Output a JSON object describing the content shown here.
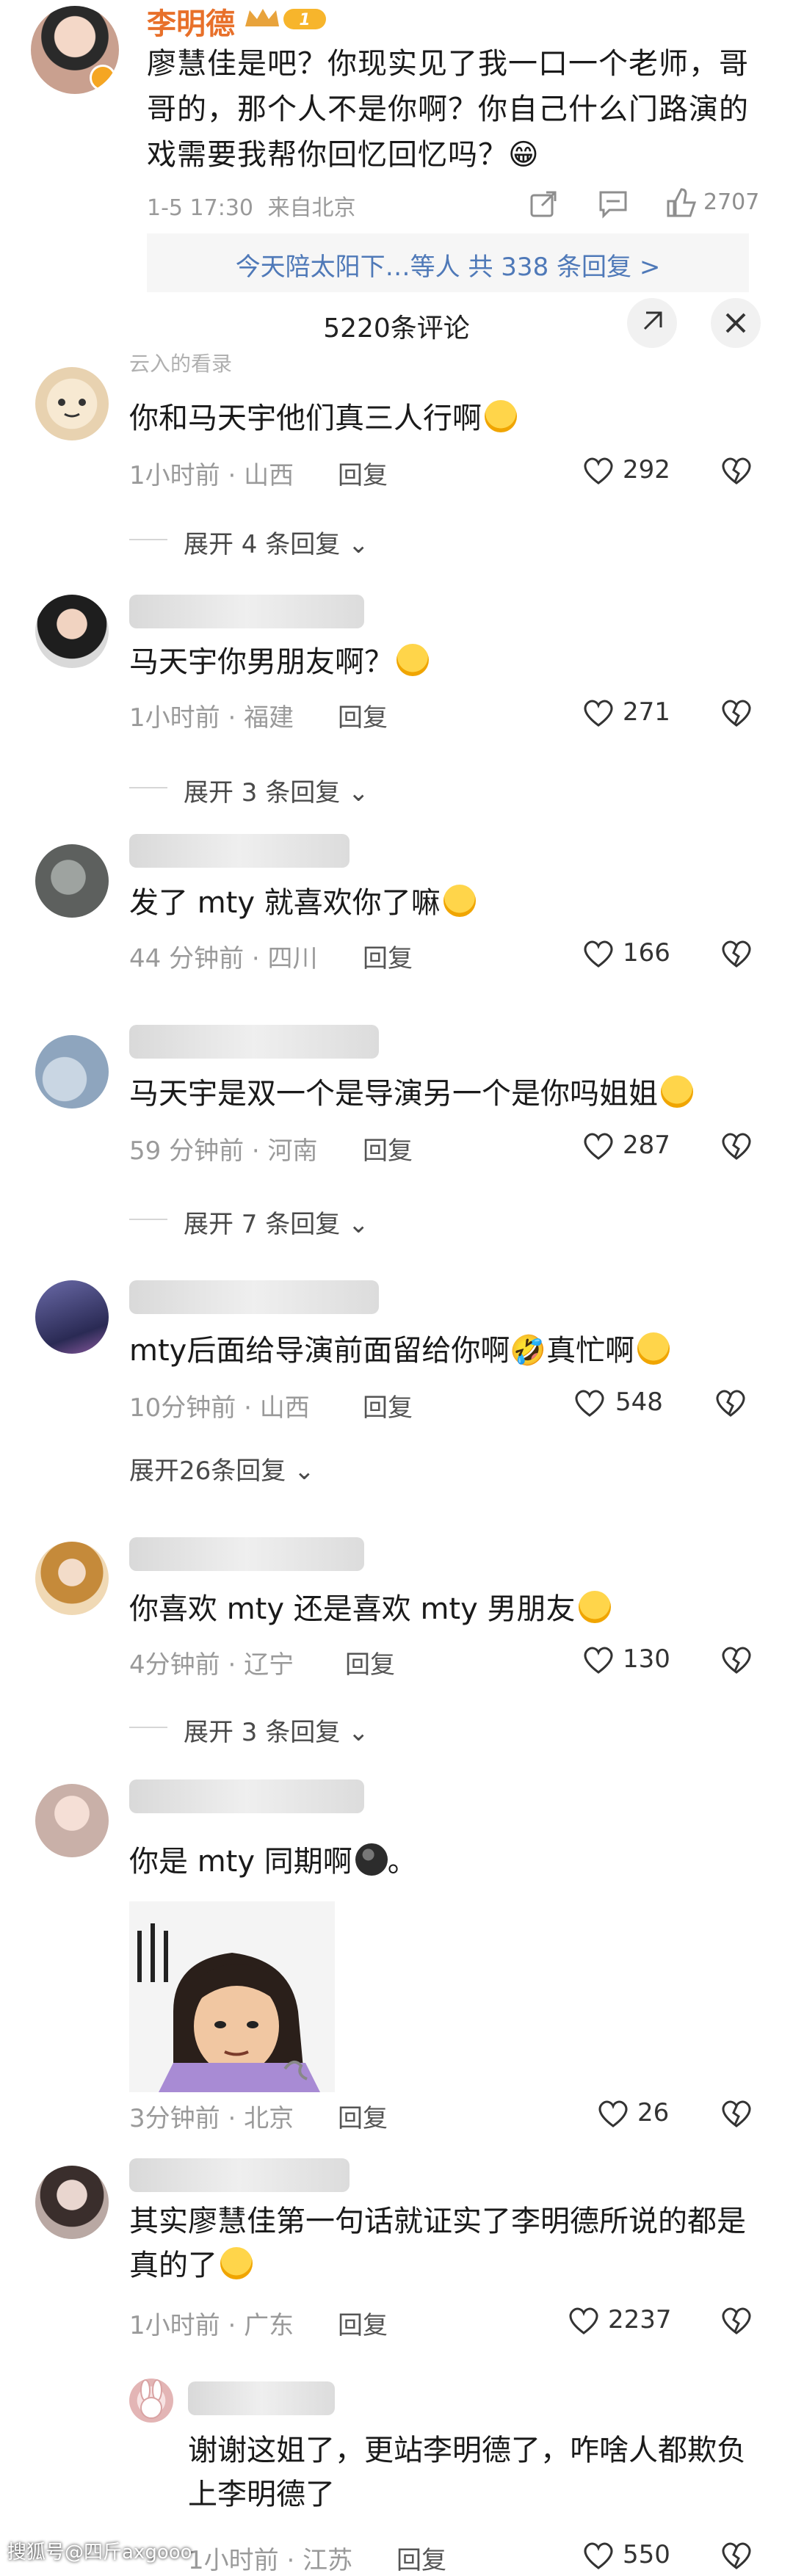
{
  "post": {
    "author": "李明德",
    "level_badge": "1",
    "text": "廖慧佳是吧？你现实见了我一口一个老师，哥哥的，那个人不是你啊？你自己什么门路演的戏需要我帮你回忆回忆吗？😁",
    "time": "1-5 17:30",
    "source": "来自北京",
    "likes": "2707",
    "replies_link": "今天陪太阳下…等人 共 338 条回复 >"
  },
  "sheet": {
    "title": "5220条评论"
  },
  "comments": [
    {
      "username": "云入的看录",
      "text": "你和马天宇他们真三人行啊",
      "emoji": "😅",
      "time": "1小时前",
      "location": "山西",
      "reply_label": "回复",
      "likes": "292",
      "expand": "展开 4 条回复"
    },
    {
      "username": "",
      "text": "马天宇你男朋友啊？",
      "emoji": "🤣",
      "time": "1小时前",
      "location": "福建",
      "reply_label": "回复",
      "likes": "271",
      "expand": "展开 3 条回复"
    },
    {
      "username": "",
      "text": "发了 mty 就喜欢你了嘛",
      "emoji": "👍🤣",
      "time": "44 分钟前",
      "location": "四川",
      "reply_label": "回复",
      "likes": "166",
      "expand": ""
    },
    {
      "username": "",
      "text": "马天宇是双一个是导演另一个是你吗姐姐",
      "emoji": "😱",
      "time": "59 分钟前",
      "location": "河南",
      "reply_label": "回复",
      "likes": "287",
      "expand": "展开 7 条回复"
    },
    {
      "username": "",
      "text": "mty后面给导演前面留给你啊🤣真忙啊",
      "emoji": "🤣",
      "time": "10分钟前",
      "location": "山西",
      "reply_label": "回复",
      "likes": "548",
      "expand": "展开26条回复"
    },
    {
      "username": "",
      "text": "你喜欢 mty 还是喜欢 mty 男朋友",
      "emoji": "😳",
      "time": "4分钟前",
      "location": "辽宁",
      "reply_label": "回复",
      "likes": "130",
      "expand": "展开 3 条回复"
    },
    {
      "username": "",
      "text": "你是 mty 同期啊",
      "emoji": "🌑。",
      "time": "3分钟前",
      "location": "北京",
      "reply_label": "回复",
      "likes": "26",
      "expand": ""
    },
    {
      "username": "",
      "text": "其实廖慧佳第一句话就证实了李明德所说的都是真的了",
      "emoji": "🤔",
      "time": "1小时前",
      "location": "广东",
      "reply_label": "回复",
      "likes": "2237",
      "expand": ""
    },
    {
      "username": "",
      "text": "谢谢这姐了，更站李明德了，咋啥人都欺负上李明德了",
      "emoji": "",
      "time": "1小时前",
      "location": "江苏",
      "reply_label": "回复",
      "likes": "550",
      "expand": ""
    }
  ],
  "watermark": "搜狐号@四斤axgooo",
  "colors": {
    "author": "#e8702a",
    "link": "#4f79b8",
    "meta": "#9a9a9a"
  }
}
